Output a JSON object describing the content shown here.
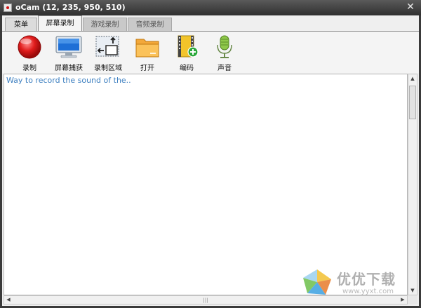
{
  "window": {
    "title": "oCam (12, 235, 950, 510)",
    "close_glyph": "✕"
  },
  "tabs": [
    {
      "label": "菜单"
    },
    {
      "label": "屏幕录制"
    },
    {
      "label": "游戏录制"
    },
    {
      "label": "音频录制"
    }
  ],
  "toolbar": {
    "items": [
      {
        "label": "录制",
        "icon": "record-icon"
      },
      {
        "label": "屏幕捕获",
        "icon": "monitor-icon"
      },
      {
        "label": "录制区域",
        "icon": "resize-region-icon"
      },
      {
        "label": "打开",
        "icon": "folder-icon"
      },
      {
        "label": "编码",
        "icon": "film-add-icon"
      },
      {
        "label": "声音",
        "icon": "microphone-icon"
      }
    ]
  },
  "content": {
    "log_text": "Way to record the sound of the.."
  },
  "watermark": {
    "text": "优优下载",
    "url": "www.yyxt.com"
  },
  "colors": {
    "accent_text": "#3d7fc0",
    "record_red": "#d81818"
  }
}
